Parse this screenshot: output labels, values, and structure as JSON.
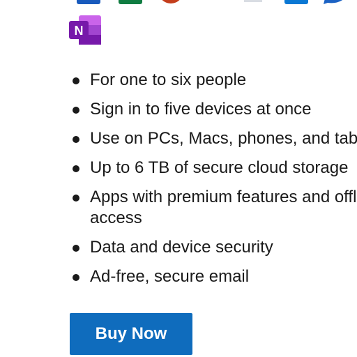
{
  "app_icons_top": [
    {
      "name": "word-icon",
      "color": "#185abd"
    },
    {
      "name": "excel-icon",
      "color": "#107c41"
    },
    {
      "name": "powerpoint-icon",
      "color": "#c43e1c"
    },
    {
      "name": "defender-icon",
      "color": "#0f6cbd"
    },
    {
      "name": "teams-icon",
      "color": "#d9dde3"
    },
    {
      "name": "outlook-icon",
      "color": "#0a78d4"
    },
    {
      "name": "skype-icon",
      "color": "#1b62c4"
    }
  ],
  "onenote": {
    "icon": "onenote-icon",
    "letter": "N",
    "colors": {
      "dark": "#7719aa",
      "mid": "#a245d0",
      "light": "#ca64ea"
    }
  },
  "features": [
    "For one to six people",
    "Sign in to five devices at once",
    "Use on PCs, Macs, phones, and tablets",
    "Up to 6 TB of secure cloud storage",
    "Apps with premium features and offline access",
    "Data and device security",
    "Ad-free, secure email"
  ],
  "cta": {
    "label": "Buy Now",
    "color": "#0f6cbd"
  }
}
